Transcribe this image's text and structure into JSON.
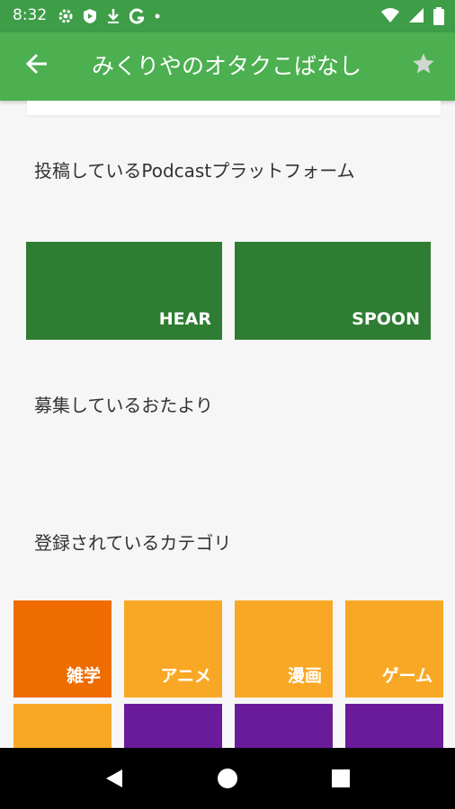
{
  "status_bar": {
    "time": "8:32",
    "icons_left": [
      "gear-icon",
      "shield-play-icon",
      "download-icon",
      "google-g-icon",
      "dot-icon"
    ],
    "icons_right": [
      "wifi-icon",
      "signal-icon",
      "battery-icon"
    ]
  },
  "toolbar": {
    "title": "みくりやのオタクこばなし",
    "back_icon": "arrow-back-icon",
    "star_icon": "star-icon"
  },
  "sections": {
    "platforms_heading": "投稿しているPodcastプラットフォーム",
    "platforms": [
      {
        "label": "HEAR",
        "color": "#2e7d32"
      },
      {
        "label": "SPOON",
        "color": "#2e7d32"
      }
    ],
    "letters_heading": "募集しているおたより",
    "categories_heading": "登録されているカテゴリ",
    "categories": [
      {
        "label": "雑学",
        "color": "#ef6c00"
      },
      {
        "label": "アニメ",
        "color": "#f9a825"
      },
      {
        "label": "漫画",
        "color": "#f9a825"
      },
      {
        "label": "ゲーム",
        "color": "#f9a825"
      },
      {
        "label": "",
        "color": "#f9a825"
      },
      {
        "label": "",
        "color": "#6a1b9a"
      },
      {
        "label": "",
        "color": "#6a1b9a"
      },
      {
        "label": "",
        "color": "#6a1b9a"
      }
    ]
  },
  "nav_bar": {
    "back_icon": "triangle-back-icon",
    "home_icon": "circle-home-icon",
    "recents_icon": "square-recents-icon"
  },
  "colors": {
    "toolbar": "#4caf50",
    "status_bar": "#3e9e48"
  }
}
